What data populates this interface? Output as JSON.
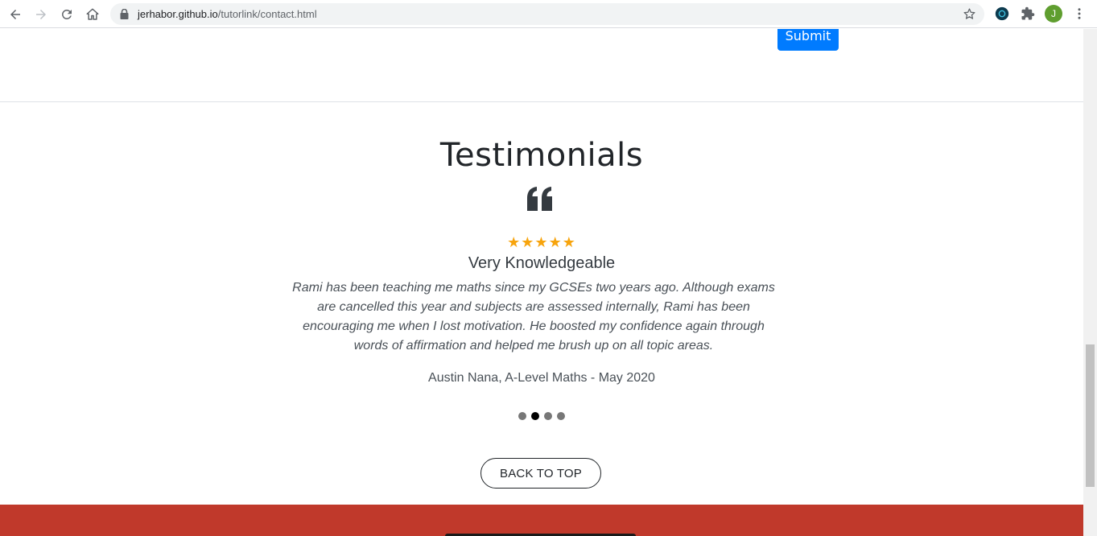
{
  "browser": {
    "url_domain": "jerhabor.github.io",
    "url_path": "/tutorlink/contact.html",
    "profile_initial": "J"
  },
  "form": {
    "submit_label": "Submit"
  },
  "testimonials": {
    "heading": "Testimonials",
    "rating_stars": "★★★★★",
    "rating": 5,
    "title": "Very Knowledgeable",
    "body": "Rami has been teaching me maths since my GCSEs two years ago. Although exams are cancelled this year and subjects are assessed internally, Rami has been encouraging me when I lost motivation. He boosted my confidence again through words of affirmation and helped me brush up on all topic areas.",
    "author": "Austin Nana, A-Level Maths - May 2020",
    "slide_count": 4,
    "active_slide": 2
  },
  "back_to_top_label": "BACK TO TOP",
  "colors": {
    "primary": "#007bff",
    "star": "#f7a40d",
    "footer": "#c0392b"
  }
}
